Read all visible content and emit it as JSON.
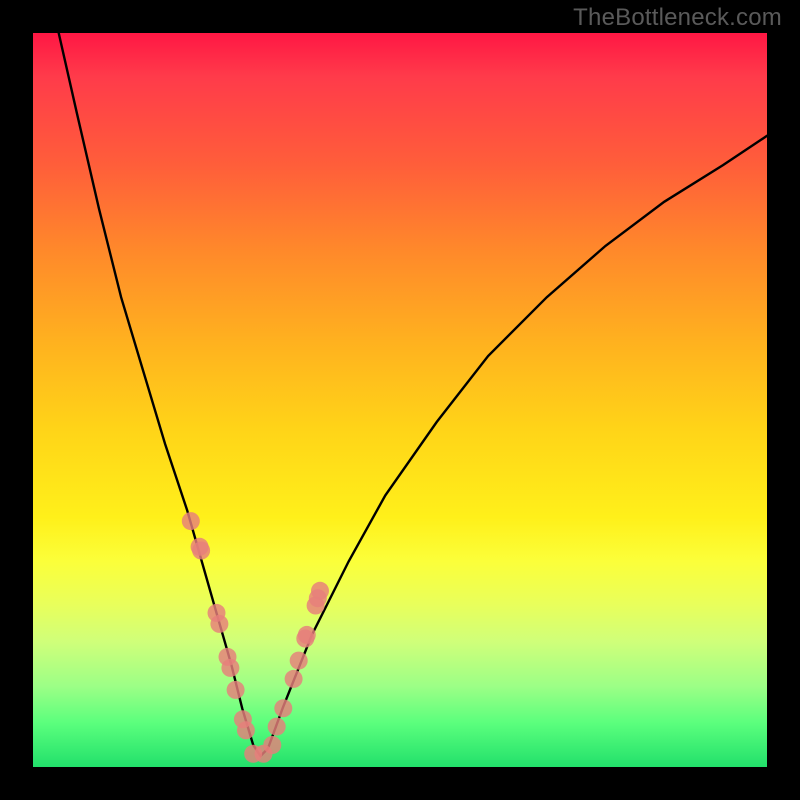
{
  "watermark": "TheBottleneck.com",
  "chart_data": {
    "type": "line",
    "title": "",
    "xlabel": "",
    "ylabel": "",
    "xlim": [
      0,
      100
    ],
    "ylim": [
      0,
      100
    ],
    "grid": false,
    "legend": false,
    "annotations": [],
    "series": [
      {
        "name": "bottleneck-curve",
        "color": "#000000",
        "x": [
          3.5,
          6,
          9,
          12,
          15,
          18,
          21,
          23,
          25,
          27,
          28.5,
          30,
          31,
          32,
          34,
          38,
          43,
          48,
          55,
          62,
          70,
          78,
          86,
          94,
          100
        ],
        "y": [
          100,
          89,
          76,
          64,
          54,
          44,
          35,
          28,
          21,
          14,
          8,
          3,
          1.5,
          2.5,
          8,
          18,
          28,
          37,
          47,
          56,
          64,
          71,
          77,
          82,
          86
        ]
      },
      {
        "name": "data-points",
        "color": "#e77f7b",
        "marker": "circle",
        "x": [
          21.5,
          22.7,
          22.9,
          25.0,
          25.4,
          26.5,
          26.9,
          27.6,
          28.6,
          29.0,
          30.0,
          31.4,
          32.6,
          33.2,
          34.1,
          35.5,
          36.2,
          37.1,
          37.3,
          38.5,
          38.8,
          39.1
        ],
        "y": [
          33.5,
          30.0,
          29.5,
          21.0,
          19.5,
          15.0,
          13.5,
          10.5,
          6.5,
          5.0,
          1.8,
          1.8,
          3.0,
          5.5,
          8.0,
          12.0,
          14.5,
          17.5,
          18.0,
          22.0,
          23.0,
          24.0
        ]
      }
    ]
  }
}
